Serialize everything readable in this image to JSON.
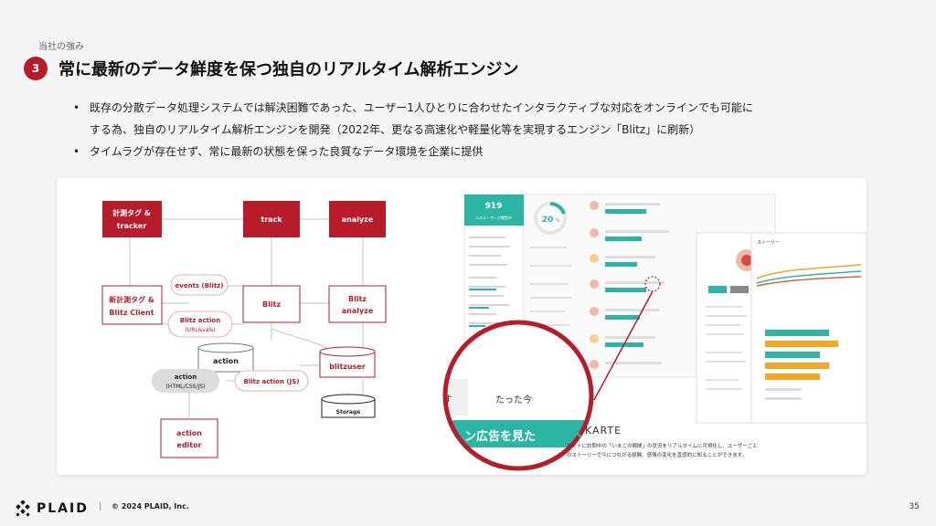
{
  "section_label": "当社の強み",
  "badge_number": "3",
  "title": "常に最新のデータ鮮度を保つ独自のリアルタイム解析エンジン",
  "bullets": [
    "既存の分散データ処理システムでは解決困難であった、ユーザー1人ひとりに合わせたインタラクティブな対応をオンラインでも可能に",
    "する為、独自のリアルタイム解析エンジンを開発（2022年、更なる高速化や軽量化等を実現するエンジン「Blitz」に刷新）",
    "タイムラグが存在せず、常に最新の状態を保った良質なデータ環境を企業に提供"
  ],
  "diagram": {
    "box_tag_tracker": [
      "計測タグ &",
      "tracker"
    ],
    "box_track": "track",
    "box_analyze": "analyze",
    "box_new_tag": [
      "新計測タグ &",
      "Blitz Client"
    ],
    "box_blitz": "Blitz",
    "box_blitz_analyze": [
      "Blitz",
      "analyze"
    ],
    "pill_events": "events (Blitz)",
    "pill_blitz_action": [
      "Blitz action",
      "(URL&vals)"
    ],
    "cyl_action": "action",
    "pill_action_html": [
      "action",
      "(HTML/CSS/JS)"
    ],
    "pill_blitz_action_js": "Blitz action (JS)",
    "cyl_blitzuser": "blitzuser",
    "cyl_storage": "Storage",
    "box_action_editor": [
      "action",
      "editor"
    ]
  },
  "screen": {
    "metric_value": "919",
    "metric_caption": "人のユーザーが閲覧中",
    "ring_value": "20",
    "ring_unit": "%",
    "zoom_time": "たった今",
    "zoom_char": "す",
    "zoom_button": "ン広告を見た",
    "brand": "KARTE",
    "caption_lines": [
      "サイトに訪問中の「いまこの瞬間」の状況をリアルタイムに可視化し、ユーザーごと",
      "のストーリーで今につながる経験、感情の変化を直感的に知ることができます。"
    ],
    "story_label": "ストーリー"
  },
  "footer": {
    "logo": "PLAID",
    "separator": "|",
    "copyright": "© 2024 PLAID, Inc.",
    "page_number": "35"
  },
  "colors": {
    "accent": "#b81c2b",
    "teal": "#2bb5a3"
  }
}
